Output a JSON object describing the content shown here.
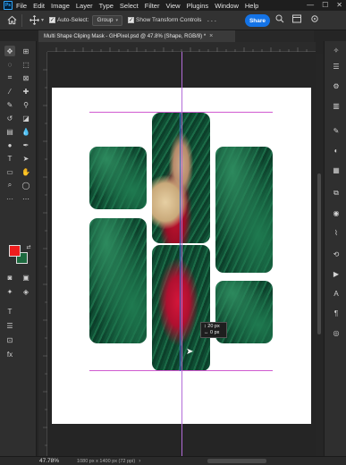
{
  "app": {
    "logo": "Ps"
  },
  "menu": [
    "File",
    "Edit",
    "Image",
    "Layer",
    "Type",
    "Select",
    "Filter",
    "View",
    "Plugins",
    "Window",
    "Help"
  ],
  "window_controls": {
    "minimize": "—",
    "maximize": "☐",
    "close": "✕"
  },
  "options": {
    "auto_select_label": "Auto-Select:",
    "auto_select_checked": true,
    "group_value": "Group",
    "show_transform_label": "Show Transform Controls",
    "show_transform_checked": true,
    "share_label": "Share"
  },
  "document": {
    "tab_title": "Multi Shape Cliping Mask - GHPixel.psd @ 47.8% (Shape, RGB/8) *",
    "close_symbol": "×"
  },
  "colors": {
    "foreground": "#ee1d1d",
    "background": "#1d6a3f",
    "accent": "#1473e6",
    "guide": "#d05ad0"
  },
  "measurement": {
    "line1": "↕ 20 px",
    "line2": "↔ 0 px"
  },
  "status": {
    "zoom": "47.78%",
    "info": "1080 px x 1400 px (72 ppi)"
  },
  "left_tools": [
    "move-icon",
    "artboard-icon",
    "marquee-icon",
    "lasso-icon",
    "object-select-icon",
    "crop-icon",
    "frame-icon",
    "eyedropper-icon",
    "healing-icon",
    "brush-icon",
    "clone-stamp-icon",
    "history-brush-icon",
    "eraser-icon",
    "gradient-icon",
    "blur-icon",
    "dodge-icon",
    "pen-icon",
    "type-icon",
    "path-select-icon",
    "rectangle-icon",
    "hand-icon",
    "zoom-icon",
    "more-tools-icon"
  ],
  "right_panels": [
    "ai-icon",
    "properties-icon",
    "adjustments-icon",
    "libraries-icon",
    "brushes-icon",
    "color-icon",
    "swatches-icon",
    "layers-icon",
    "channels-icon",
    "paths-icon",
    "history-icon",
    "actions-icon",
    "character-icon",
    "paragraph-icon",
    "glyphs-icon"
  ]
}
